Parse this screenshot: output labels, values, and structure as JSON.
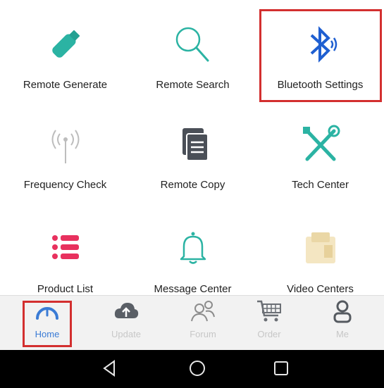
{
  "grid": {
    "items": [
      {
        "label": "Remote Generate",
        "icon": "usb-stick-icon"
      },
      {
        "label": "Remote Search",
        "icon": "magnifier-icon"
      },
      {
        "label": "Bluetooth Settings",
        "icon": "bluetooth-icon"
      },
      {
        "label": "Frequency Check",
        "icon": "antenna-signal-icon"
      },
      {
        "label": "Remote Copy",
        "icon": "copy-document-icon"
      },
      {
        "label": "Tech Center",
        "icon": "tools-icon"
      },
      {
        "label": "Product List",
        "icon": "list-icon"
      },
      {
        "label": "Message Center",
        "icon": "bell-icon"
      },
      {
        "label": "Video Centers",
        "icon": "video-folder-icon"
      }
    ]
  },
  "tabbar": {
    "tabs": [
      {
        "label": "Home",
        "icon": "gauge-icon",
        "active": true
      },
      {
        "label": "Update",
        "icon": "cloud-upload-icon",
        "active": false
      },
      {
        "label": "Forum",
        "icon": "people-icon",
        "active": false
      },
      {
        "label": "Order",
        "icon": "cart-icon",
        "active": false
      },
      {
        "label": "Me",
        "icon": "person-icon",
        "active": false
      }
    ]
  },
  "colors": {
    "teal": "#2bb3a3",
    "dark": "#4a4f57",
    "pink": "#e8315e",
    "bluetooth": "#1f5fd1",
    "active_tab": "#3a7bd5",
    "highlight": "#d32f2f"
  }
}
